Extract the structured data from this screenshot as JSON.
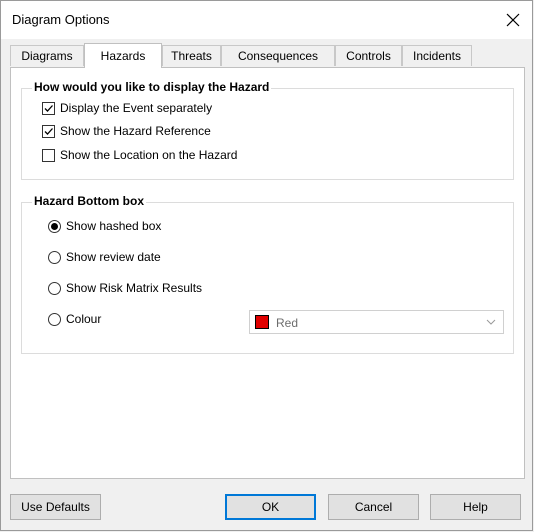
{
  "window": {
    "title": "Diagram Options"
  },
  "tabs": [
    {
      "label": "Diagrams"
    },
    {
      "label": "Hazards"
    },
    {
      "label": "Threats"
    },
    {
      "label": "Consequences"
    },
    {
      "label": "Controls"
    },
    {
      "label": "Incidents"
    }
  ],
  "active_tab": "Hazards",
  "display_group": {
    "title": "How would you like to display the Hazard",
    "options": [
      {
        "label": "Display the Event separately",
        "checked": true
      },
      {
        "label": "Show the Hazard Reference",
        "checked": true
      },
      {
        "label": "Show the Location on the Hazard",
        "checked": false
      }
    ]
  },
  "bottom_group": {
    "title": "Hazard Bottom box",
    "options": [
      {
        "label": "Show hashed box",
        "selected": true
      },
      {
        "label": "Show review date",
        "selected": false
      },
      {
        "label": "Show Risk Matrix Results",
        "selected": false
      },
      {
        "label": "Colour",
        "selected": false
      }
    ],
    "colour_select": {
      "value": "Red",
      "swatch": "#e00000"
    }
  },
  "buttons": {
    "defaults": "Use Defaults",
    "ok": "OK",
    "cancel": "Cancel",
    "help": "Help"
  },
  "colors": {
    "accent": "#0078d7"
  }
}
